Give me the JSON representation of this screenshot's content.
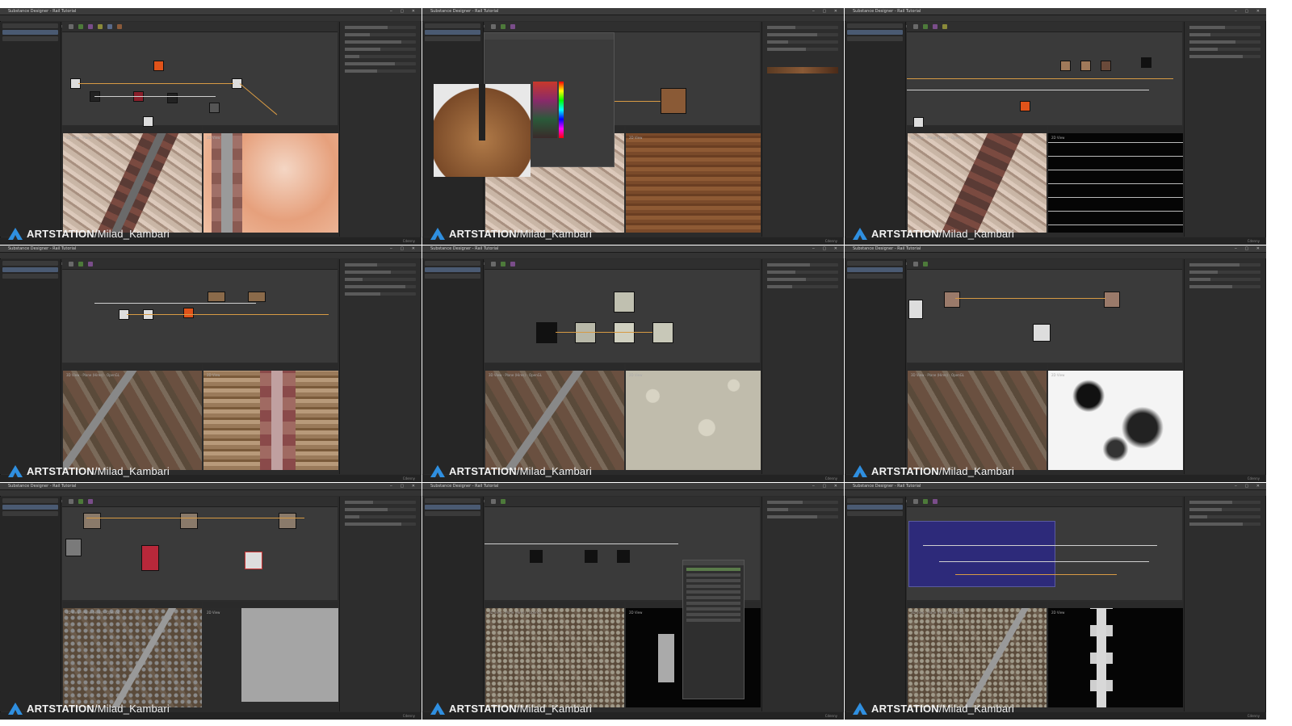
{
  "watermark": {
    "brand": "ARTSTATION",
    "path": "/Milad_Kambari"
  },
  "window": {
    "title": "Substance Designer - Rail Tutorial",
    "menus": [
      "File",
      "Edit",
      "Tools",
      "Windows",
      "Help"
    ],
    "status_right": "Cdenny"
  },
  "panels": {
    "explorer": "Explorer",
    "graph": "Graph",
    "properties": "Properties",
    "viewport3d": "3D View - Plane (Hires) - OpenGL",
    "viewport2d": "2D View"
  },
  "colors": {
    "accent": "#2f8fe0",
    "wire": "#d79a44",
    "background": "#2b2b2b"
  },
  "icons": [
    "artstation-logo-icon",
    "window-controls-icon",
    "node-icon"
  ],
  "cells": [
    {
      "id": "r1c1",
      "preview2d": "rust-rail-top"
    },
    {
      "id": "r1c2",
      "preview2d": "wood-plank",
      "popup": "color-picker"
    },
    {
      "id": "r1c3",
      "preview2d": "dark-streaks"
    },
    {
      "id": "r2c1",
      "preview2d": "wood-sleeper"
    },
    {
      "id": "r2c2",
      "preview2d": "stone-heightmap"
    },
    {
      "id": "r2c3",
      "preview2d": "noise-mask"
    },
    {
      "id": "r3c1",
      "preview2d": "flat-gray"
    },
    {
      "id": "r3c2",
      "preview2d": "black-mask",
      "popup": "node-library-menu"
    },
    {
      "id": "r3c3",
      "preview2d": "rail-mask"
    }
  ]
}
